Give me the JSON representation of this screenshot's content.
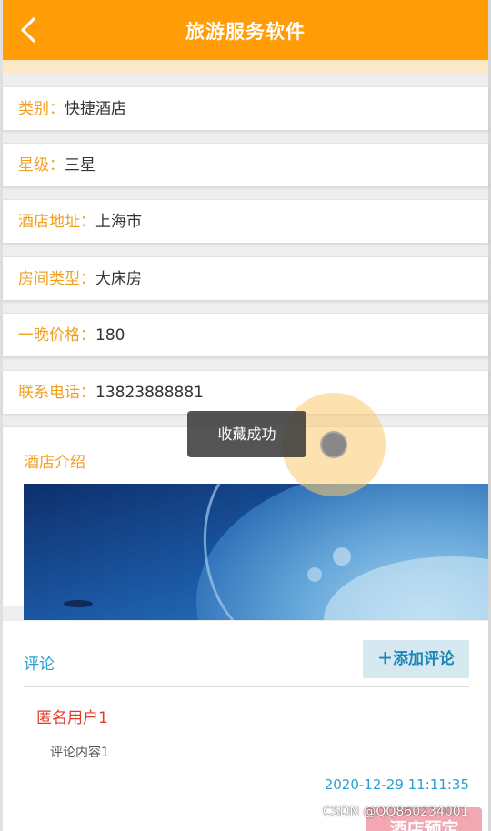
{
  "header": {
    "title": "旅游服务软件",
    "back_icon": "chevron-left-icon"
  },
  "hotel_info": [
    {
      "label": "类别：",
      "value": "快捷酒店"
    },
    {
      "label": "星级：",
      "value": "三星"
    },
    {
      "label": "酒店地址：",
      "value": "上海市"
    },
    {
      "label": "房间类型：",
      "value": "大床房"
    },
    {
      "label": "一晚价格：",
      "value": "180"
    },
    {
      "label": "联系电话：",
      "value": "13823888881"
    }
  ],
  "intro": {
    "title": "酒店介绍"
  },
  "comments": {
    "title": "评论",
    "add_button": "＋添加评论",
    "items": [
      {
        "user": "匿名用户1",
        "content": "评论内容1",
        "time": "2020-12-29 11:11:35"
      }
    ]
  },
  "toast": "收藏成功",
  "reserve_button": "酒店预定",
  "watermark": "CSDN @QQ860234001",
  "colors": {
    "header": "#ff9c06",
    "label": "#f0a020",
    "accent_blue": "#2aa0cf",
    "username": "#e23b2a"
  }
}
